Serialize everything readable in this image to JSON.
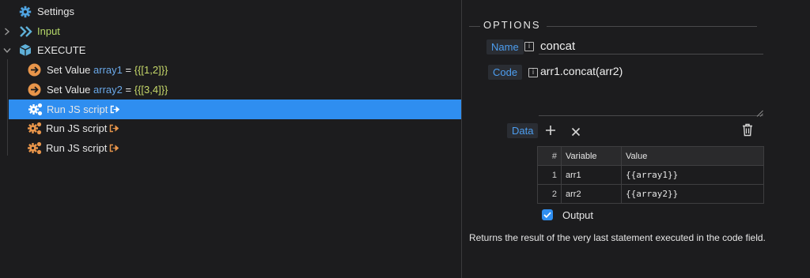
{
  "tree": {
    "settings_label": "Settings",
    "input_label": "Input",
    "execute_label": "EXECUTE",
    "steps": [
      {
        "action": "Set Value",
        "param": "array1",
        "eq": " = ",
        "value": "{{[1,2]}}"
      },
      {
        "action": "Set Value",
        "param": "array2",
        "eq": " = ",
        "value": "{{[3,4]}}"
      },
      {
        "action": "Run JS script",
        "selected": true
      },
      {
        "action": "Run JS script"
      },
      {
        "action": "Run JS script"
      }
    ]
  },
  "options": {
    "title": "OPTIONS",
    "name_label": "Name",
    "name_value": "concat",
    "code_label": "Code",
    "code_value": "arr1.concat(arr2)",
    "data_label": "Data",
    "table": {
      "headers": [
        "#",
        "Variable",
        "Value"
      ],
      "rows": [
        {
          "num": "1",
          "variable": "arr1",
          "value": "{{array1}}"
        },
        {
          "num": "2",
          "variable": "arr2",
          "value": "{{array2}}"
        }
      ]
    },
    "output_label": "Output",
    "output_checked": true,
    "description": "Returns the result of the very last statement executed in the code field."
  },
  "colors": {
    "background": "#1c1c1e",
    "selection": "#2f8ef0",
    "param_name": "#6aa8e8",
    "param_value": "#c7d96a",
    "input_label": "#b6d96a",
    "step_icon": "#e8954a",
    "label_blue": "#4d9ef0"
  }
}
